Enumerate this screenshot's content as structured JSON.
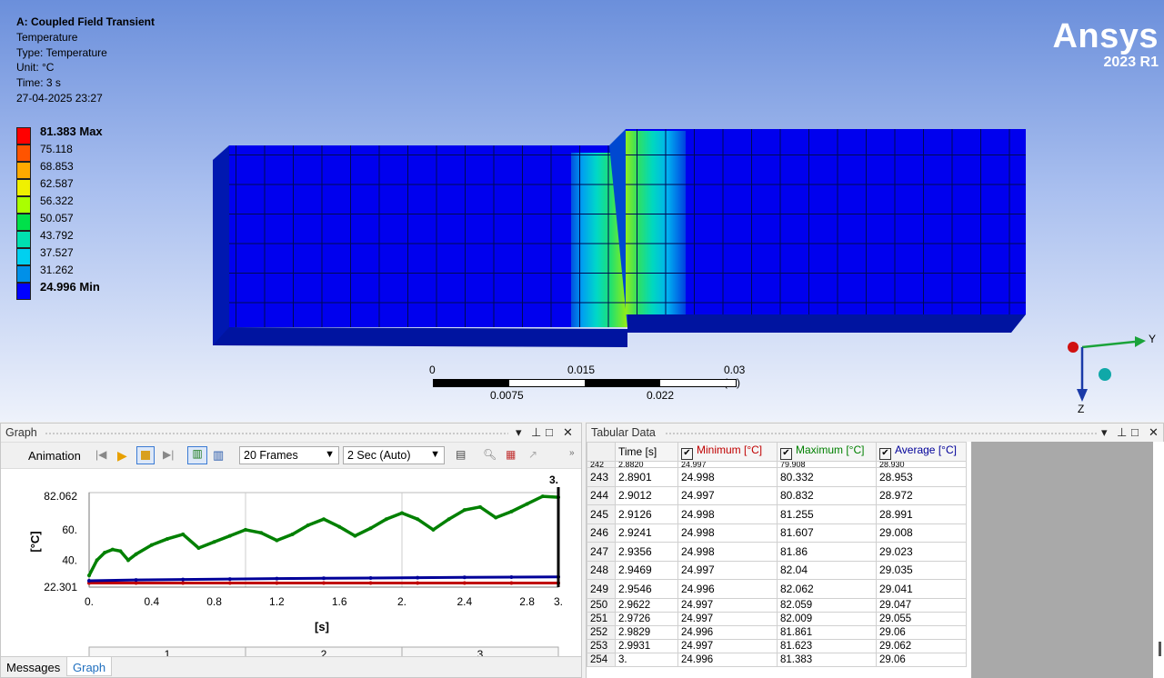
{
  "viewport": {
    "analysis_title": "A: Coupled Field Transient",
    "result_name": "Temperature",
    "type_line": "Type: Temperature",
    "unit_line": "Unit: °C",
    "time_line": "Time: 3 s",
    "date_line": "27-04-2025 23:27",
    "legend": [
      {
        "label": "81.383 Max",
        "color": "#ff0000",
        "bold": true
      },
      {
        "label": "75.118",
        "color": "#ff5400"
      },
      {
        "label": "68.853",
        "color": "#ffaa00"
      },
      {
        "label": "62.587",
        "color": "#f0f000"
      },
      {
        "label": "56.322",
        "color": "#aaff00"
      },
      {
        "label": "50.057",
        "color": "#00e04a"
      },
      {
        "label": "43.792",
        "color": "#00e0b0"
      },
      {
        "label": "37.527",
        "color": "#00d0f0"
      },
      {
        "label": "31.262",
        "color": "#0090e8"
      },
      {
        "label": "24.996 Min",
        "color": "#0000ff",
        "bold": true
      }
    ],
    "logo": {
      "name": "Ansys",
      "version": "2023 R1"
    },
    "scale": {
      "top_labels": [
        "0",
        "0.015",
        "0.03 (m)"
      ],
      "bottom_labels": [
        "0.0075",
        "0.022"
      ]
    },
    "axes": {
      "y": "Y",
      "z": "Z"
    }
  },
  "graph_panel": {
    "title": "Graph",
    "animation_label": "Animation",
    "frames_value": "20 Frames",
    "duration_value": "2 Sec (Auto)",
    "time_marker": "3.",
    "y_label": "[°C]",
    "x_label": "[s]",
    "step_labels": [
      "1",
      "2",
      "3"
    ]
  },
  "chart_data": {
    "type": "line",
    "xlabel": "[s]",
    "ylabel": "[°C]",
    "x_ticks": [
      "0.",
      "0.4",
      "0.8",
      "1.2",
      "1.6",
      "2.",
      "2.4",
      "2.8",
      "3."
    ],
    "y_ticks": [
      "82.062",
      "60.",
      "40.",
      "22.301"
    ],
    "xlim": [
      0,
      3
    ],
    "ylim": [
      22.301,
      82.062
    ],
    "series": [
      {
        "name": "Minimum [°C]",
        "color": "#c00000",
        "x": [
          0,
          0.3,
          0.6,
          0.9,
          1.2,
          1.5,
          1.8,
          2.1,
          2.4,
          2.7,
          3.0
        ],
        "y": [
          25.0,
          25.0,
          25.0,
          25.0,
          25.0,
          25.0,
          25.0,
          25.0,
          25.0,
          25.0,
          24.996
        ]
      },
      {
        "name": "Maximum [°C]",
        "color": "#008000",
        "x": [
          0,
          0.05,
          0.1,
          0.15,
          0.2,
          0.25,
          0.3,
          0.4,
          0.5,
          0.6,
          0.7,
          0.8,
          0.9,
          1.0,
          1.1,
          1.2,
          1.3,
          1.4,
          1.5,
          1.6,
          1.7,
          1.8,
          1.9,
          2.0,
          2.1,
          2.2,
          2.3,
          2.4,
          2.5,
          2.6,
          2.7,
          2.8,
          2.9,
          3.0
        ],
        "y": [
          30,
          40,
          45,
          47,
          46,
          40,
          44,
          50,
          54,
          57,
          48,
          52,
          56,
          60,
          58,
          53,
          57,
          63,
          67,
          62,
          56,
          61,
          67,
          71,
          67,
          60,
          67,
          73,
          75,
          68,
          72,
          77,
          82,
          81.383
        ]
      },
      {
        "name": "Average [°C]",
        "color": "#000099",
        "x": [
          0,
          0.3,
          0.6,
          0.9,
          1.2,
          1.5,
          1.8,
          2.1,
          2.4,
          2.7,
          3.0
        ],
        "y": [
          26.5,
          27.0,
          27.3,
          27.6,
          27.9,
          28.1,
          28.3,
          28.5,
          28.7,
          28.9,
          29.06
        ]
      }
    ]
  },
  "table_panel": {
    "title": "Tabular Data",
    "columns": [
      "Time [s]",
      "Minimum [°C]",
      "Maximum [°C]",
      "Average [°C]"
    ],
    "partial_row": [
      "242",
      "2.8820",
      "24.997",
      "79.908",
      "28.930"
    ],
    "rows": [
      [
        "243",
        "2.8901",
        "24.998",
        "80.332",
        "28.953"
      ],
      [
        "244",
        "2.9012",
        "24.997",
        "80.832",
        "28.972"
      ],
      [
        "245",
        "2.9126",
        "24.998",
        "81.255",
        "28.991"
      ],
      [
        "246",
        "2.9241",
        "24.998",
        "81.607",
        "29.008"
      ],
      [
        "247",
        "2.9356",
        "24.998",
        "81.86",
        "29.023"
      ],
      [
        "248",
        "2.9469",
        "24.997",
        "82.04",
        "29.035"
      ],
      [
        "249",
        "2.9546",
        "24.996",
        "82.062",
        "29.041"
      ],
      [
        "250",
        "2.9622",
        "24.997",
        "82.059",
        "29.047"
      ],
      [
        "251",
        "2.9726",
        "24.997",
        "82.009",
        "29.055"
      ],
      [
        "252",
        "2.9829",
        "24.996",
        "81.861",
        "29.06"
      ],
      [
        "253",
        "2.9931",
        "24.997",
        "81.623",
        "29.062"
      ],
      [
        "254",
        "3.",
        "24.996",
        "81.383",
        "29.06"
      ]
    ]
  },
  "bottom_tabs": [
    "Messages",
    "Graph"
  ]
}
